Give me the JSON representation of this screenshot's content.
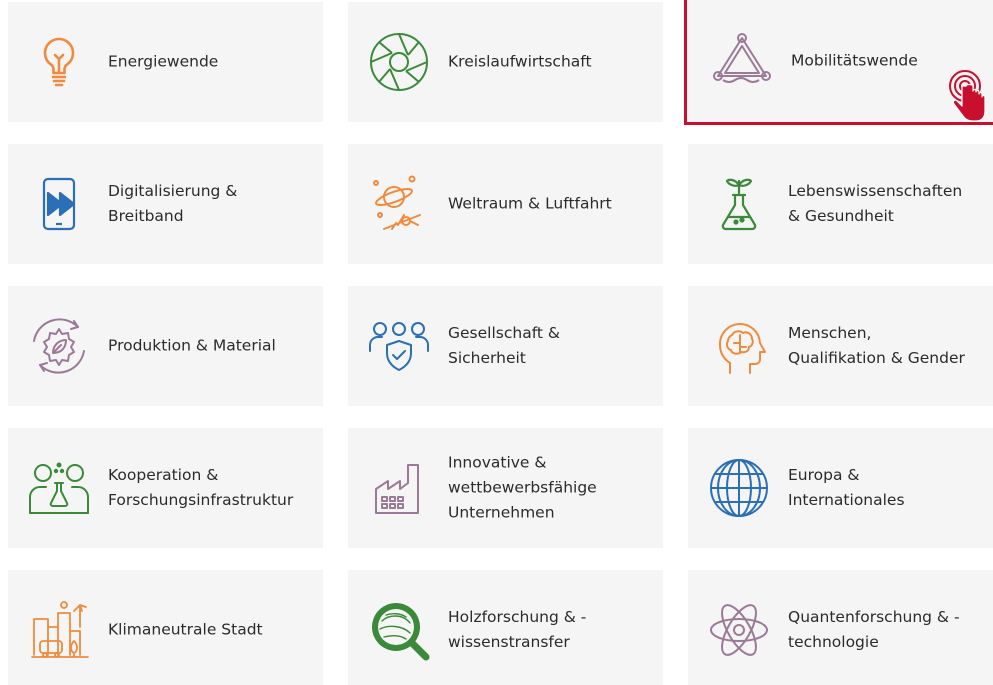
{
  "tiles": [
    {
      "label": "Energiewende",
      "icon": "lightbulb-icon",
      "color": "#f08a3c"
    },
    {
      "label": "Kreislaufwirtschaft",
      "icon": "aperture-icon",
      "color": "#3a8a3a"
    },
    {
      "label": "Mobilitätswende",
      "icon": "triangle-wheels-icon",
      "color": "#9a7a96"
    },
    {
      "label": "Digitalisierung &\nBreitband",
      "icon": "smartphone-forward-icon",
      "color": "#2b6fb6"
    },
    {
      "label": "Weltraum & Luftfahrt",
      "icon": "planet-airplane-icon",
      "color": "#f08a3c"
    },
    {
      "label": "Lebenswissenschaften\n& Gesundheit",
      "icon": "flask-plant-icon",
      "color": "#3a8a3a"
    },
    {
      "label": "Produktion & Material",
      "icon": "gear-leaf-icon",
      "color": "#9a7a96"
    },
    {
      "label": "Gesellschaft &\nSicherheit",
      "icon": "people-shield-icon",
      "color": "#2b6fb6"
    },
    {
      "label": "Menschen,\nQualifikation & Gender",
      "icon": "head-brain-icon",
      "color": "#f08a3c"
    },
    {
      "label": "Kooperation &\nForschungsinfrastruktur",
      "icon": "researchers-icon",
      "color": "#3a8a3a"
    },
    {
      "label": "Innovative &\nwettbewerbsfähige\nUnternehmen",
      "icon": "factory-icon",
      "color": "#9a7a96"
    },
    {
      "label": "Europa &\nInternationales",
      "icon": "globe-icon",
      "color": "#2b6fb6"
    },
    {
      "label": "Klimaneutrale Stadt",
      "icon": "city-icon",
      "color": "#f08a3c"
    },
    {
      "label": "Holzforschung & -\nwissenstransfer",
      "icon": "wood-magnifier-icon",
      "color": "#3a8a3a"
    },
    {
      "label": "Quantenforschung & -\ntechnologie",
      "icon": "atom-icon",
      "color": "#9a7a96"
    }
  ],
  "accent_color": "#c8102e",
  "tile_background": "#f5f5f5"
}
